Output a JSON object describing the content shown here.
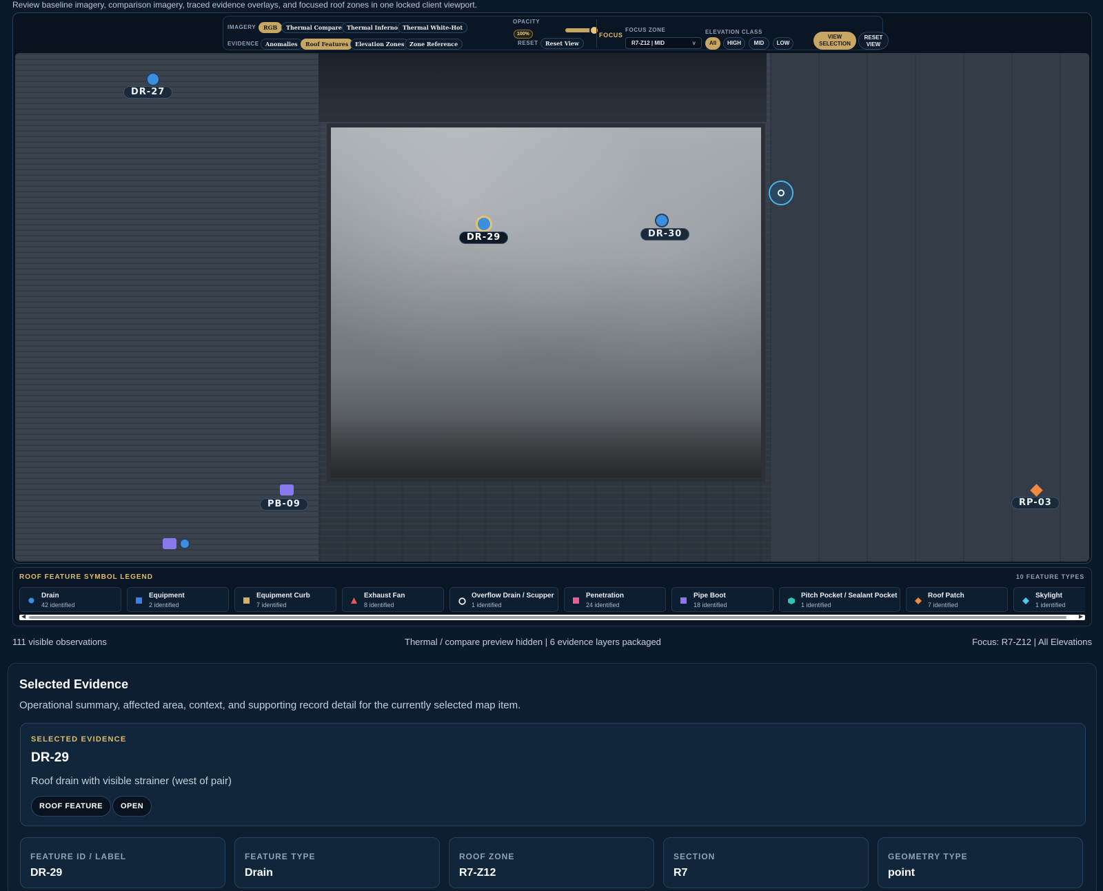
{
  "intro": "Review baseline imagery, comparison imagery, traced evidence overlays, and focused roof zones in one locked client viewport.",
  "toolbar": {
    "imagery_label": "IMAGERY",
    "imagery_options": [
      "RGB",
      "Thermal Compare",
      "Thermal Inferno",
      "Thermal White-Hot"
    ],
    "imagery_selected": "RGB",
    "evidence_label": "EVIDENCE",
    "evidence_options": [
      "Anomalies",
      "Roof Features",
      "Elevation Zones",
      "Zone Reference"
    ],
    "evidence_selected": "Roof Features",
    "opacity_label": "OPACITY",
    "opacity_value": "100%",
    "opacity_level": 1.0,
    "reset_label": "RESET",
    "reset_view_button": "Reset View",
    "focus_label": "FOCUS",
    "focus_zone_label": "FOCUS ZONE",
    "focus_zone_value": "R7-Z12 | MID",
    "focus_zone_chevron": "v",
    "elevation_label": "ELEVATION CLASS",
    "elevation_options": [
      "All",
      "HIGH",
      "MID",
      "LOW"
    ],
    "elevation_selected": "All",
    "view_selection_button": [
      "VIEW",
      "SELECTION"
    ],
    "reset_view_button_2": [
      "RESET",
      "VIEW"
    ]
  },
  "map": {
    "markers": [
      {
        "id": "DR-27",
        "kind": "drain"
      },
      {
        "id": "DR-29",
        "kind": "drain",
        "selected": true
      },
      {
        "id": "DR-30",
        "kind": "drain"
      },
      {
        "id": "PB-09",
        "kind": "pipe-boot"
      },
      {
        "id": "RP-03",
        "kind": "roof-patch"
      }
    ]
  },
  "legend": {
    "title": "ROOF FEATURE SYMBOL LEGEND",
    "count": "10 FEATURE TYPES",
    "items": [
      {
        "name": "Drain",
        "count": "42 identified",
        "icon": "circle",
        "color": "#3b8fe0"
      },
      {
        "name": "Equipment",
        "count": "2 identified",
        "icon": "square",
        "color": "#3b7fe8"
      },
      {
        "name": "Equipment Curb",
        "count": "7 identified",
        "icon": "square",
        "color": "#d4b062"
      },
      {
        "name": "Exhaust Fan",
        "count": "8 identified",
        "icon": "triangle",
        "color": "#e85a5a"
      },
      {
        "name": "Overflow Drain / Scupper",
        "count": "1 identified",
        "icon": "ring",
        "color": "#e8eef4"
      },
      {
        "name": "Penetration",
        "count": "24 identified",
        "icon": "square",
        "color": "#ea5d94"
      },
      {
        "name": "Pipe Boot",
        "count": "18 identified",
        "icon": "square",
        "color": "#8a78f0"
      },
      {
        "name": "Pitch Pocket / Sealant Pocket",
        "count": "1 identified",
        "icon": "hex",
        "color": "#2fc2b0"
      },
      {
        "name": "Roof Patch",
        "count": "7 identified",
        "icon": "diamond",
        "color": "#f08a3c"
      },
      {
        "name": "Skylight",
        "count": "1 identified",
        "icon": "diamond",
        "color": "#4cc8f0"
      }
    ]
  },
  "status": {
    "left": "111 visible observations",
    "center": "Thermal / compare preview hidden | 6 evidence layers packaged",
    "right": "Focus: R7-Z12 | All Elevations"
  },
  "selected": {
    "title": "Selected Evidence",
    "subtitle": "Operational summary, affected area, context, and supporting record detail for the currently selected map item.",
    "kicker": "SELECTED EVIDENCE",
    "id": "DR-29",
    "description": "Roof drain with visible strainer (west of pair)",
    "tags": [
      "ROOF FEATURE",
      "OPEN"
    ],
    "fields": [
      {
        "label": "FEATURE ID / LABEL",
        "value": "DR-29"
      },
      {
        "label": "FEATURE TYPE",
        "value": "Drain"
      },
      {
        "label": "ROOF ZONE",
        "value": "R7-Z12"
      },
      {
        "label": "SECTION",
        "value": "R7"
      },
      {
        "label": "GEOMETRY TYPE",
        "value": "point"
      }
    ]
  }
}
